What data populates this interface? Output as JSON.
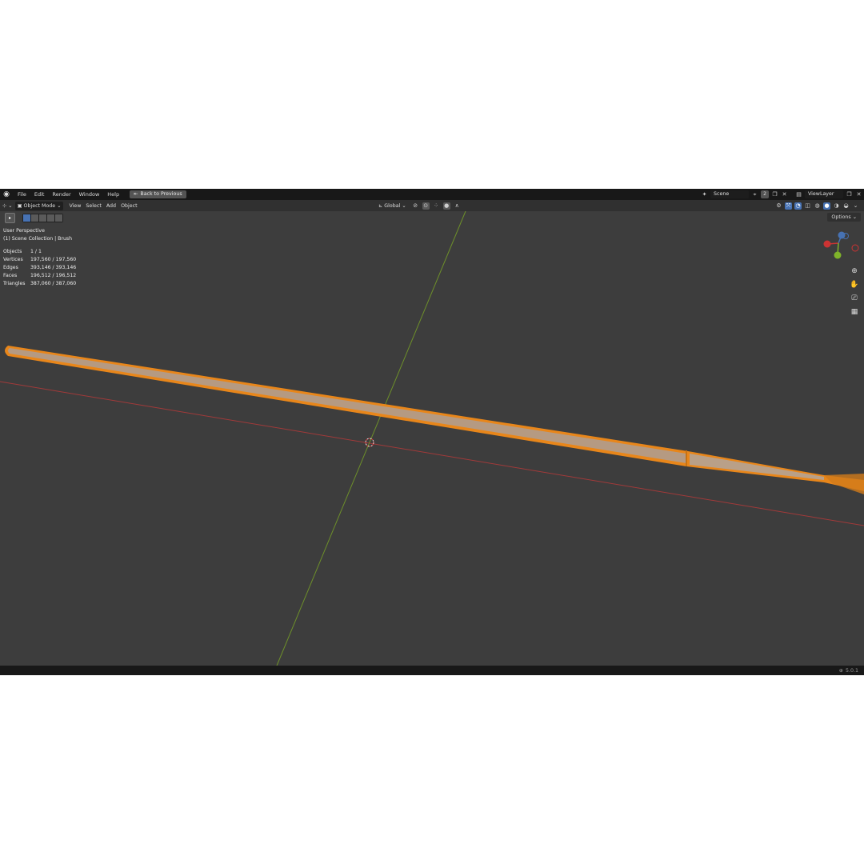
{
  "topbar": {
    "menu": [
      "File",
      "Edit",
      "Render",
      "Window",
      "Help"
    ],
    "back_button": "Back to Previous",
    "scene_name": "Scene",
    "scene_count": "2",
    "view_layer": "ViewLayer"
  },
  "header": {
    "mode": "Object Mode",
    "menu": [
      "View",
      "Select",
      "Add",
      "Object"
    ],
    "orientation": "Global",
    "options": "Options"
  },
  "overlay": {
    "perspective": "User Perspective",
    "collection": "(1) Scene Collection | Brush",
    "stats": [
      {
        "label": "Objects",
        "value": "1 / 1"
      },
      {
        "label": "Vertices",
        "value": "197,560 / 197,560"
      },
      {
        "label": "Edges",
        "value": "393,146 / 393,146"
      },
      {
        "label": "Faces",
        "value": "196,512 / 196,512"
      },
      {
        "label": "Triangles",
        "value": "387,060 / 387,060"
      }
    ]
  },
  "gizmo": {
    "z": "Z",
    "x": "X",
    "y": "Y"
  },
  "colors": {
    "selection": "#e8861a",
    "mesh": "#b59a82",
    "x_axis": "#a13a3a",
    "y_axis": "#6d8f2a",
    "viewport_bg": "#3d3d3d",
    "accent": "#4772b3"
  },
  "status": {
    "version": "5.0.1"
  }
}
